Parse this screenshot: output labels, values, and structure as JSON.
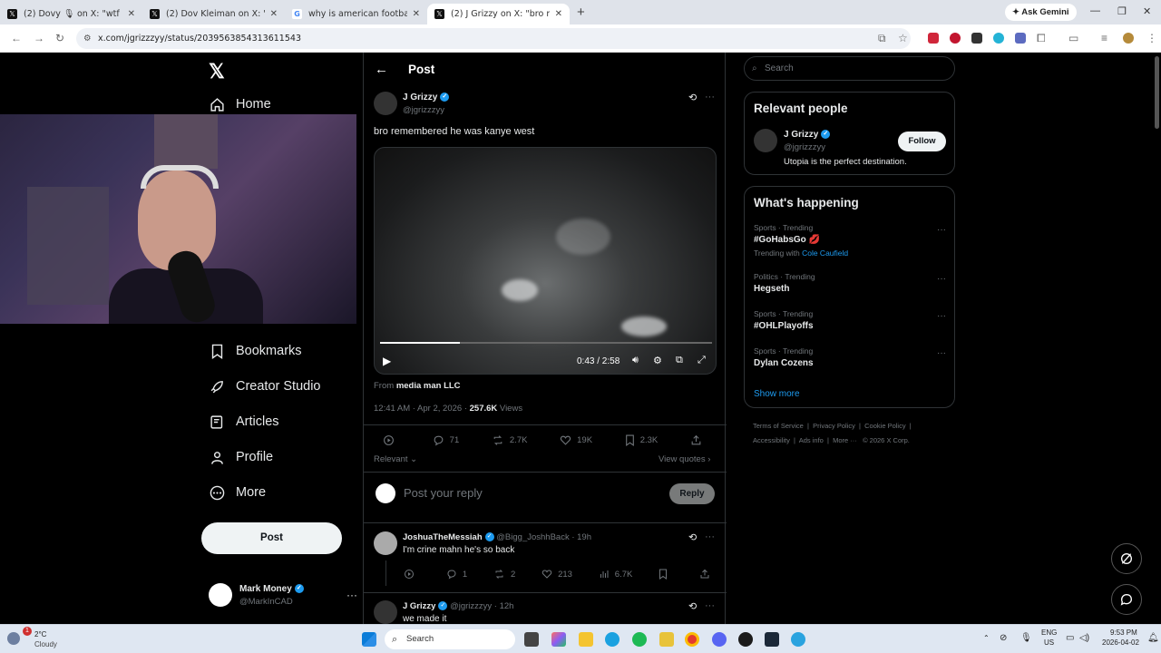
{
  "browser": {
    "tabs": [
      {
        "title": "(2) Dovy 🎙 on X: \"wtf Sean Str",
        "icon": "x-icon"
      },
      {
        "title": "(2) Dov Kleiman on X: \"Wow: P",
        "icon": "x-icon"
      },
      {
        "title": "why is american football called",
        "icon": "google-icon"
      },
      {
        "title": "(2) J Grizzy on X: \"bro rememb",
        "icon": "x-icon"
      }
    ],
    "ask_gemini": "Ask Gemini",
    "url": "x.com/jgrizzzyy/status/2039563854313611543"
  },
  "nav": {
    "items": [
      {
        "label": "Home",
        "icon": "home-icon"
      },
      {
        "label": "Bookmarks",
        "icon": "bookmark-icon"
      },
      {
        "label": "Creator Studio",
        "icon": "rocket-icon"
      },
      {
        "label": "Articles",
        "icon": "article-icon"
      },
      {
        "label": "Profile",
        "icon": "profile-icon"
      },
      {
        "label": "More",
        "icon": "more-icon"
      }
    ],
    "post_button": "Post",
    "me": {
      "name": "Mark Money",
      "handle": "@MarkInCAD"
    }
  },
  "post": {
    "header": "Post",
    "author_name": "J Grizzy",
    "author_handle": "@jgrizzzyy",
    "text": "bro remembered he was kanye west",
    "video_time": "0:43 / 2:58",
    "video_progress": 0.24,
    "from_prefix": "From",
    "from_name": "media man LLC",
    "timestamp": "12:41 AM · Apr 2, 2026 · ",
    "views_count": "257.6K",
    "views_label": "Views",
    "stats": {
      "replies": "71",
      "reposts": "2.7K",
      "likes": "19K",
      "bookmarks": "2.3K"
    },
    "sort_label": "Relevant",
    "view_quotes": "View quotes",
    "reply_placeholder": "Post your reply",
    "reply_button": "Reply"
  },
  "replies": [
    {
      "name": "JoshuaTheMessiah",
      "handle": "@Bigg_JoshhBack · 19h",
      "text": "I'm crine mahn he's so back",
      "replies": "1",
      "reposts": "2",
      "likes": "213",
      "views": "6.7K"
    },
    {
      "name": "J Grizzy",
      "handle": "@jgrizzzyy · 12h",
      "text": "we made it"
    }
  ],
  "sidebar": {
    "search_placeholder": "Search",
    "relevant_title": "Relevant people",
    "person": {
      "name": "J Grizzy",
      "handle": "@jgrizzzyy",
      "bio": "Utopia is the perfect destination.",
      "follow": "Follow"
    },
    "happening_title": "What's happening",
    "trends": [
      {
        "category": "Sports · Trending",
        "name": "#GoHabsGo 💋",
        "extra_prefix": "Trending with",
        "extra_link": "Cole Caufield"
      },
      {
        "category": "Politics · Trending",
        "name": "Hegseth"
      },
      {
        "category": "Sports · Trending",
        "name": "#OHLPlayoffs"
      },
      {
        "category": "Sports · Trending",
        "name": "Dylan Cozens"
      }
    ],
    "show_more": "Show more",
    "footer": [
      "Terms of Service",
      "Privacy Policy",
      "Cookie Policy",
      "Accessibility",
      "Ads info",
      "More ···",
      "© 2026 X Corp."
    ]
  },
  "taskbar": {
    "weather_temp": "2°C",
    "weather_desc": "Cloudy",
    "search": "Search",
    "lang": "ENG",
    "region": "US",
    "time": "9:53 PM",
    "date": "2026-04-02",
    "notif_badge": "1"
  },
  "colors": {
    "accent": "#1d9bf0",
    "bg": "#000000",
    "muted": "#71767b"
  }
}
